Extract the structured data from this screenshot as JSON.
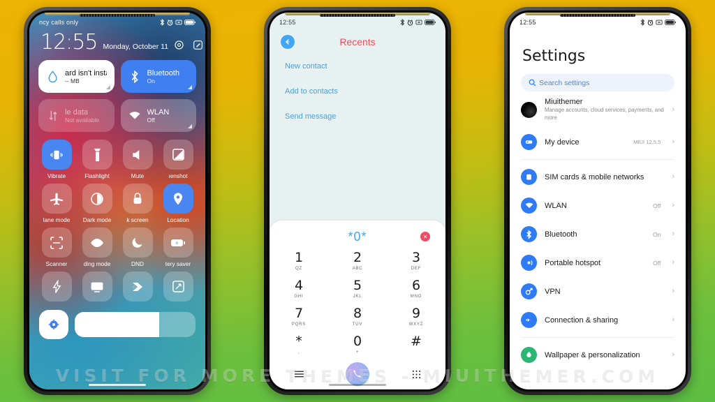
{
  "watermark": "VISIT FOR MORE THEMES - MIUITHEMER.COM",
  "colors": {
    "background_top": "#eeb303",
    "background_bottom": "#5cbe43",
    "accent_blue": "#3f7ff0",
    "recents_red": "#e8505b",
    "dial_blue": "#42a5f5",
    "settings_icon_blue": "#2f7bf6"
  },
  "phone1": {
    "statusbar": {
      "carrier": "ncy calls only",
      "icons": [
        "bluetooth-icon",
        "alarm-icon",
        "vibrate-icon",
        "battery-icon"
      ]
    },
    "clock": {
      "time": "12:55",
      "date": "Monday, October 11"
    },
    "clock_icons": [
      "settings-gear-icon",
      "edit-icon"
    ],
    "big_tiles": [
      {
        "title": "ard isn't install",
        "sub": "-- MB",
        "icon": "water-drop-icon",
        "style": "white"
      },
      {
        "title": "Bluetooth",
        "sub": "On",
        "icon": "bluetooth-icon",
        "style": "blue"
      },
      {
        "title": "le data",
        "sub": "Not available",
        "icon": "mobile-data-icon",
        "style": "dim"
      },
      {
        "title": "WLAN",
        "sub": "Off",
        "icon": "wifi-icon",
        "style": "glass"
      }
    ],
    "small_tiles": [
      {
        "label": "Vibrate",
        "icon": "vibrate-icon",
        "on": true
      },
      {
        "label": "Flashlight",
        "icon": "flashlight-icon",
        "on": false
      },
      {
        "label": "Mute",
        "icon": "mute-icon",
        "on": false
      },
      {
        "label": "ıenshot",
        "icon": "screenshot-icon",
        "on": false
      },
      {
        "label": "lane mode",
        "icon": "airplane-icon",
        "on": false
      },
      {
        "label": "Dark mode",
        "icon": "dark-mode-icon",
        "on": false
      },
      {
        "label": "k screen",
        "icon": "lock-icon",
        "on": false
      },
      {
        "label": "Location",
        "icon": "location-pin-icon",
        "on": true
      },
      {
        "label": "Scanner",
        "icon": "scanner-icon",
        "on": false
      },
      {
        "label": "ding mode",
        "icon": "reading-mode-icon",
        "on": false
      },
      {
        "label": "DND",
        "icon": "moon-icon",
        "on": false
      },
      {
        "label": "tery saver",
        "icon": "battery-saver-icon",
        "on": false
      },
      {
        "label": "",
        "icon": "lightning-icon",
        "on": false
      },
      {
        "label": "",
        "icon": "cast-icon",
        "on": false
      },
      {
        "label": "",
        "icon": "color-mode-icon",
        "on": false
      },
      {
        "label": "",
        "icon": "auto-rotate-icon",
        "on": false
      }
    ],
    "bottom": {
      "gear": "settings-gear-icon",
      "brightness_percent": 70
    }
  },
  "phone2": {
    "statusbar": {
      "time": "12:55",
      "icons": [
        "bluetooth-icon",
        "alarm-icon",
        "vibrate-icon",
        "battery-icon"
      ]
    },
    "header": {
      "back": "back-arrow-icon",
      "title": "Recents"
    },
    "menu": [
      {
        "label": "New contact"
      },
      {
        "label": "Add to contacts"
      },
      {
        "label": "Send message"
      }
    ],
    "keypad": {
      "entered_number": "*0*",
      "delete": "delete-icon",
      "keys": [
        {
          "digit": "1",
          "letters": "QZ"
        },
        {
          "digit": "2",
          "letters": "ABC"
        },
        {
          "digit": "3",
          "letters": "DEF"
        },
        {
          "digit": "4",
          "letters": "GHI"
        },
        {
          "digit": "5",
          "letters": "JKL"
        },
        {
          "digit": "6",
          "letters": "MNO"
        },
        {
          "digit": "7",
          "letters": "PQRS"
        },
        {
          "digit": "8",
          "letters": "TUV"
        },
        {
          "digit": "9",
          "letters": "WXYZ"
        },
        {
          "digit": "*",
          "letters": ","
        },
        {
          "digit": "0",
          "letters": "+"
        },
        {
          "digit": "#",
          "letters": ""
        }
      ],
      "bottom_bar": [
        "menu-icon",
        "call-button-icon",
        "keypad-icon"
      ]
    }
  },
  "phone3": {
    "statusbar": {
      "time": "12:55",
      "icons": [
        "bluetooth-icon",
        "alarm-icon",
        "vibrate-icon",
        "battery-icon"
      ]
    },
    "title": "Settings",
    "search": {
      "placeholder": "Search settings",
      "icon": "search-icon"
    },
    "account": {
      "name": "Miuithemer",
      "desc": "Manage accounts, cloud services, payments, and more",
      "icon": "avatar-icon"
    },
    "items": [
      {
        "name": "My device",
        "value": "MIUI 12.5.5",
        "icon": "device-icon",
        "divider_after": true
      },
      {
        "name": "SIM cards & mobile networks",
        "value": "",
        "icon": "sim-card-icon",
        "divider_after": false
      },
      {
        "name": "WLAN",
        "value": "Off",
        "icon": "wifi-icon",
        "divider_after": false
      },
      {
        "name": "Bluetooth",
        "value": "On",
        "icon": "bluetooth-icon",
        "divider_after": false
      },
      {
        "name": "Portable hotspot",
        "value": "Off",
        "icon": "hotspot-icon",
        "divider_after": false
      },
      {
        "name": "VPN",
        "value": "",
        "icon": "vpn-icon",
        "divider_after": false
      },
      {
        "name": "Connection & sharing",
        "value": "",
        "icon": "connection-sharing-icon",
        "divider_after": true
      },
      {
        "name": "Wallpaper & personalization",
        "value": "",
        "icon": "wallpaper-icon",
        "divider_after": false
      }
    ]
  }
}
